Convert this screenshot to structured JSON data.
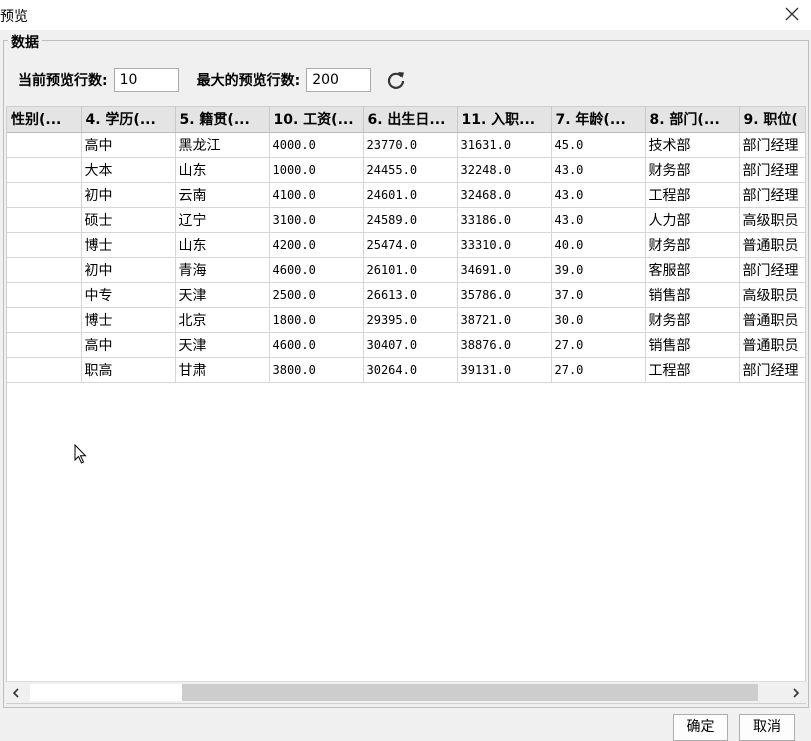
{
  "window": {
    "title": "预览"
  },
  "group": {
    "label": "数据"
  },
  "controls": {
    "current_label": "当前预览行数:",
    "current_value": "10",
    "max_label": "最大的预览行数:",
    "max_value": "200"
  },
  "table": {
    "headers": [
      "性别(...",
      "4. 学历(...",
      "5. 籍贯(...",
      "10. 工资(...",
      "6. 出生日...",
      "11. 入职...",
      "7. 年龄(...",
      "8. 部门(...",
      "9. 职位("
    ],
    "rows": [
      [
        "",
        "高中",
        "黑龙江",
        "4000.0",
        "23770.0",
        "31631.0",
        "45.0",
        "技术部",
        "部门经理"
      ],
      [
        "",
        "大本",
        "山东",
        "1000.0",
        "24455.0",
        "32248.0",
        "43.0",
        "财务部",
        "部门经理"
      ],
      [
        "",
        "初中",
        "云南",
        "4100.0",
        "24601.0",
        "32468.0",
        "43.0",
        "工程部",
        "部门经理"
      ],
      [
        "",
        "硕士",
        "辽宁",
        "3100.0",
        "24589.0",
        "33186.0",
        "43.0",
        "人力部",
        "高级职员"
      ],
      [
        "",
        "博士",
        "山东",
        "4200.0",
        "25474.0",
        "33310.0",
        "40.0",
        "财务部",
        "普通职员"
      ],
      [
        "",
        "初中",
        "青海",
        "4600.0",
        "26101.0",
        "34691.0",
        "39.0",
        "客服部",
        "部门经理"
      ],
      [
        "",
        "中专",
        "天津",
        "2500.0",
        "26613.0",
        "35786.0",
        "37.0",
        "销售部",
        "高级职员"
      ],
      [
        "",
        "博士",
        "北京",
        "1800.0",
        "29395.0",
        "38721.0",
        "30.0",
        "财务部",
        "普通职员"
      ],
      [
        "",
        "高中",
        "天津",
        "4600.0",
        "30407.0",
        "38876.0",
        "27.0",
        "销售部",
        "普通职员"
      ],
      [
        "",
        "职高",
        "甘肃",
        "3800.0",
        "30264.0",
        "39131.0",
        "27.0",
        "工程部",
        "部门经理"
      ]
    ]
  },
  "buttons": {
    "ok": "确定",
    "cancel": "取消"
  },
  "icons": {
    "close": "close-icon",
    "refresh": "refresh-icon",
    "scroll_left": "chevron-left-icon",
    "scroll_right": "chevron-right-icon",
    "cursor": "mouse-pointer-icon"
  }
}
